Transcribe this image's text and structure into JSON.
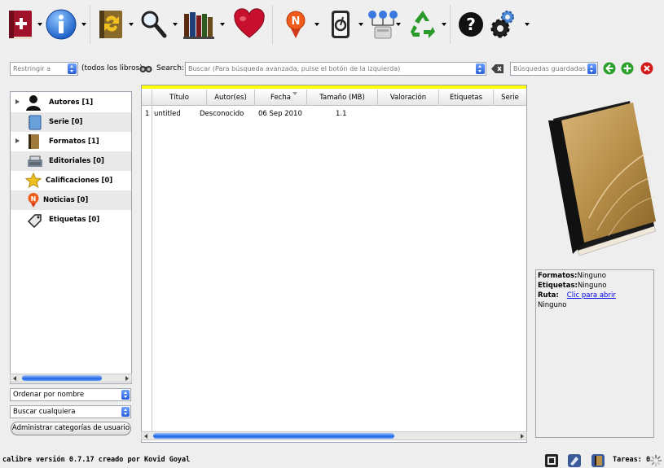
{
  "toolbar": {
    "buttons": [
      {
        "name": "add-books",
        "icon": "add-book-icon"
      },
      {
        "name": "edit-metadata",
        "icon": "info-icon"
      },
      {
        "name": "convert-books",
        "icon": "convert-icon"
      },
      {
        "name": "view",
        "icon": "magnifier-icon"
      },
      {
        "name": "library",
        "icon": "books-icon"
      },
      {
        "name": "donate",
        "icon": "heart-icon"
      },
      {
        "name": "fetch-news",
        "icon": "news-icon"
      },
      {
        "name": "send-to-device",
        "icon": "device-icon"
      },
      {
        "name": "connect-share",
        "icon": "network-icon"
      },
      {
        "name": "remove-books",
        "icon": "recycle-icon"
      },
      {
        "name": "help",
        "icon": "help-icon"
      },
      {
        "name": "preferences",
        "icon": "gears-icon"
      }
    ]
  },
  "search": {
    "restrict_placeholder": "Restringir a",
    "restrict_value": "(todos los libros)",
    "label": "Search:",
    "placeholder": "Buscar (Para búsqueda avanzada, pulse el botón de la izquierda)",
    "saved_placeholder": "Búsquedas guardadas"
  },
  "tag_browser": {
    "items": [
      {
        "label": "Autores [1]",
        "icon": "author-icon",
        "expandable": true
      },
      {
        "label": "Serie [0]",
        "icon": "series-icon",
        "expandable": false
      },
      {
        "label": "Formatos [1]",
        "icon": "book-icon",
        "expandable": true
      },
      {
        "label": "Editoriales [0]",
        "icon": "publisher-icon",
        "expandable": false
      },
      {
        "label": "Calificaciones [0]",
        "icon": "star-icon",
        "expandable": false
      },
      {
        "label": "Noticias [0]",
        "icon": "news-icon",
        "expandable": false
      },
      {
        "label": "Etiquetas [0]",
        "icon": "tag-icon",
        "expandable": false
      }
    ],
    "sort_by": "Ordenar por nombre",
    "match": "Buscar cualquiera",
    "manage_button": "Administrar categorías de usuario"
  },
  "book_list": {
    "columns": [
      "Título",
      "Autor(es)",
      "Fecha",
      "Tamaño (MB)",
      "Valoración",
      "Etiquetas",
      "Serie"
    ],
    "rows": [
      {
        "index": "1",
        "title": "untitled",
        "author": "Desconocido",
        "date": "06 Sep 2010",
        "size": "1.1",
        "rating": "",
        "tags": "",
        "series": ""
      }
    ]
  },
  "details": {
    "formats_label": "Formatos:",
    "formats_value": "Ninguno",
    "tags_label": "Etiquetas:",
    "tags_value": "Ninguno",
    "path_label": "Ruta:",
    "path_link": "Clic para abrir",
    "comments": "Ninguno"
  },
  "status": {
    "text": "calibre versión 0.7.17 creado por Kovid Goyal",
    "jobs": "Tareas: 0"
  },
  "colors": {
    "accent_blue": "#2a5fd8",
    "highlight_yellow": "#ffff00",
    "link": "#0000ee"
  }
}
